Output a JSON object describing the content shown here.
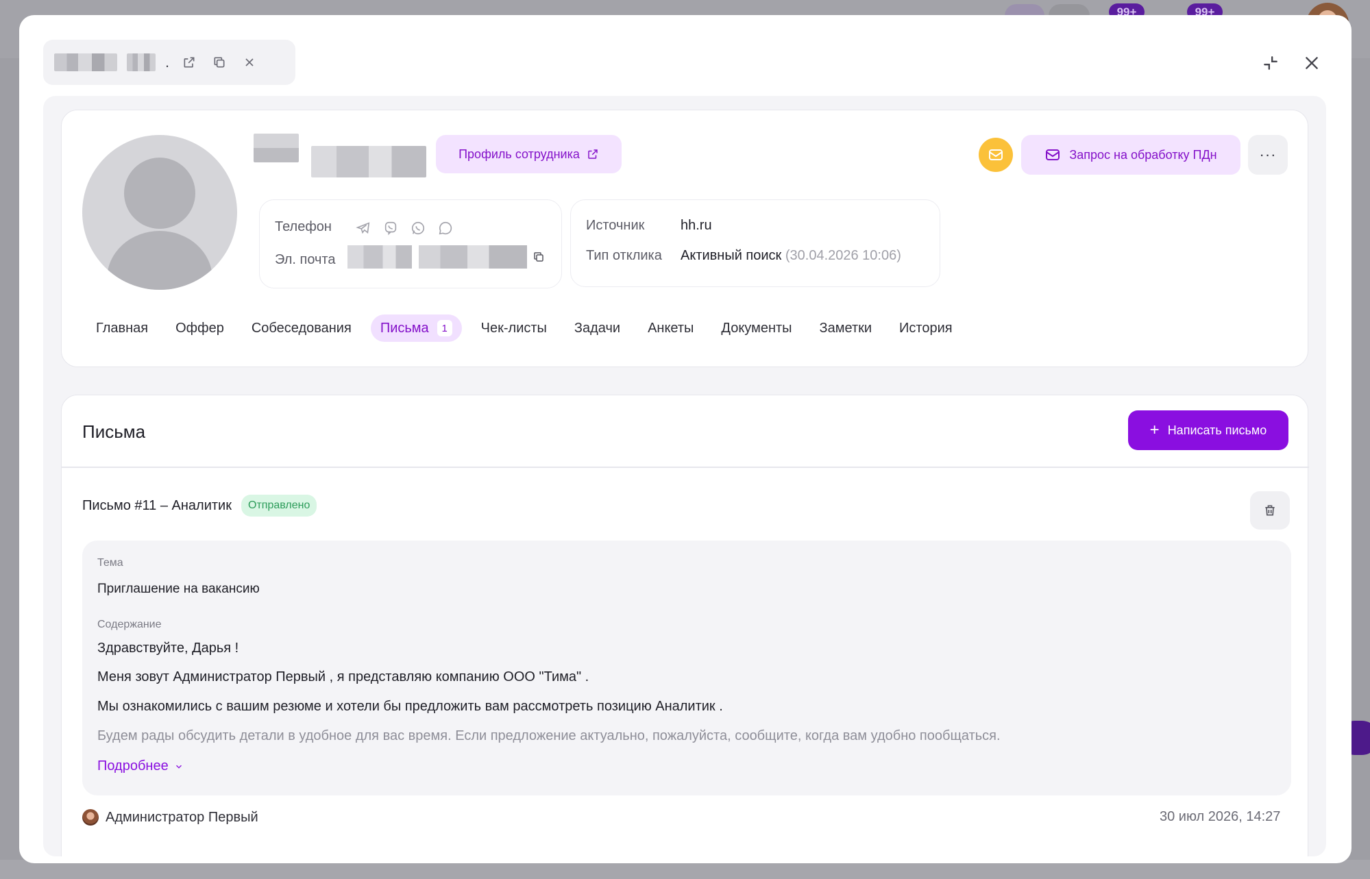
{
  "background": {
    "badges": [
      "99+",
      "99+"
    ]
  },
  "header": {
    "tab_dot": "."
  },
  "profile": {
    "employee_profile_label": "Профиль сотрудника",
    "pdn_request_label": "Запрос на обработку ПДн",
    "more_label": "···",
    "contacts": {
      "phone_label": "Телефон",
      "email_label": "Эл. почта"
    },
    "source": {
      "source_label": "Источник",
      "source_value": "hh.ru",
      "response_type_label": "Тип отклика",
      "response_type_value": "Активный поиск",
      "response_type_date": "(30.04.2026 10:06)"
    },
    "tabs": [
      {
        "label": "Главная"
      },
      {
        "label": "Оффер"
      },
      {
        "label": "Собеседования"
      },
      {
        "label": "Письма",
        "count": "1",
        "active": true
      },
      {
        "label": "Чек-листы"
      },
      {
        "label": "Задачи"
      },
      {
        "label": "Анкеты"
      },
      {
        "label": "Документы"
      },
      {
        "label": "Заметки"
      },
      {
        "label": "История"
      }
    ]
  },
  "letters": {
    "title": "Письма",
    "write_button": "Написать письмо",
    "write_button_icon": "+",
    "letter": {
      "name": "Письмо #11 – Аналитик",
      "status": "Отправлено",
      "subject_label": "Тема",
      "subject": "Приглашение на вакансию",
      "content_label": "Содержание",
      "lines": [
        "Здравствуйте, Дарья !",
        "Меня зовут Администратор Первый , я представляю компанию ООО \"Тима\" .",
        "Мы ознакомились с вашим резюме и хотели бы предложить вам рассмотреть позицию Аналитик .",
        "Будем рады обсудить детали в удобное для вас время. Если предложение актуально, пожалуйста, сообщите, когда вам удобно пообщаться."
      ],
      "more_label": "Подробнее",
      "author": "Администратор Первый",
      "date": "30 июл 2026, 14:27"
    }
  },
  "colors": {
    "accent": "#8a0fe0",
    "accent_soft": "#f3e3ff",
    "status_green": "#2c9c59",
    "mail_yellow": "#fbc13a"
  }
}
